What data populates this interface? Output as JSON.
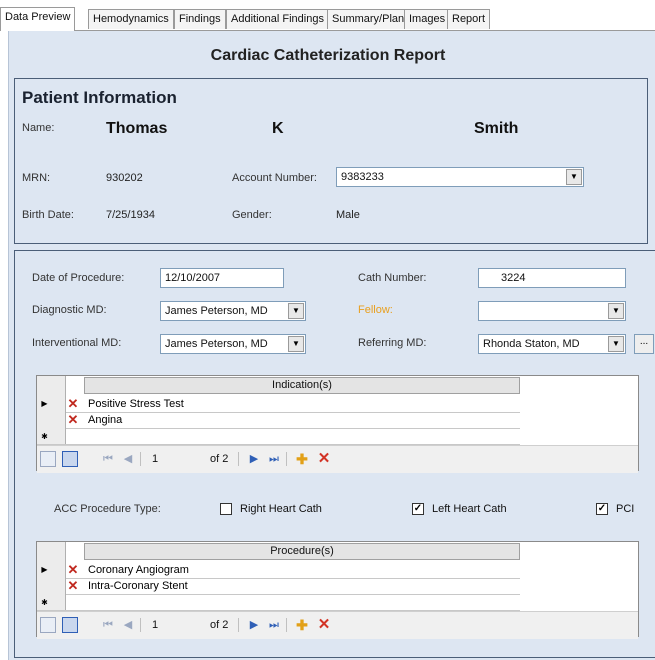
{
  "tabs": [
    {
      "label": "Data Preview"
    },
    {
      "label": "Hemodynamics"
    },
    {
      "label": "Findings"
    },
    {
      "label": "Additional Findings"
    },
    {
      "label": "Summary/Plan"
    },
    {
      "label": "Images"
    },
    {
      "label": "Report"
    }
  ],
  "report_title": "Cardiac Catheterization Report",
  "patient": {
    "section_title": "Patient Information",
    "name_label": "Name:",
    "first_name": "Thomas",
    "middle_initial": "K",
    "last_name": "Smith",
    "mrn_label": "MRN:",
    "mrn": "930202",
    "account_label": "Account Number:",
    "account_number": "9383233",
    "birth_label": "Birth Date:",
    "birth_date": "7/25/1934",
    "gender_label": "Gender:",
    "gender": "Male"
  },
  "procedure": {
    "date_label": "Date of Procedure:",
    "date": "12/10/2007",
    "cath_number_label": "Cath Number:",
    "cath_number": "3224",
    "diagnostic_label": "Diagnostic MD:",
    "diagnostic_md": "James Peterson, MD",
    "fellow_label": "Fellow:",
    "fellow": "",
    "interventional_label": "Interventional MD:",
    "interventional_md": "James Peterson, MD",
    "referring_label": "Referring MD:",
    "referring_md": "Rhonda Staton, MD",
    "ellipsis": "..."
  },
  "indications_grid": {
    "header": "Indication(s)",
    "rows": [
      "Positive Stress Test",
      "Angina"
    ],
    "page": "1",
    "of_pages": "of 2"
  },
  "acc_type": {
    "label": "ACC Procedure Type:",
    "options": [
      {
        "label": "Right Heart Cath",
        "checked": false
      },
      {
        "label": "Left Heart Cath",
        "checked": true
      },
      {
        "label": "PCI",
        "checked": true
      }
    ]
  },
  "procedures_grid": {
    "header": "Procedure(s)",
    "rows": [
      "Coronary Angiogram",
      "Intra-Coronary Stent"
    ],
    "page": "1",
    "of_pages": "of 2"
  },
  "icons": {
    "row_pointer": "triangle-right",
    "new_row": "asterisk",
    "delete": "red-x",
    "add": "orange-plus"
  },
  "colors": {
    "form_background": "#dde6f2",
    "panel_border": "#4b5e78",
    "fellow_label": "#e8a020",
    "delete_icon": "#c0281e",
    "nav_blue": "#2f5fb6"
  }
}
